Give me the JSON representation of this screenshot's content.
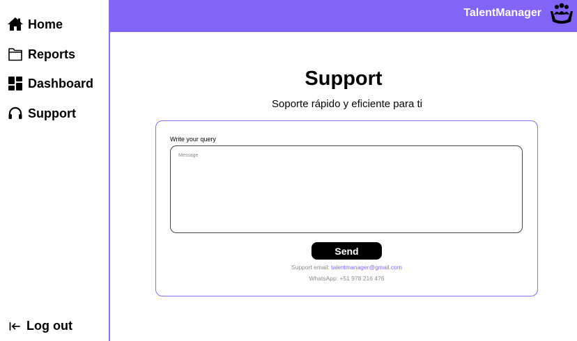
{
  "sidebar": {
    "items": [
      {
        "label": "Home",
        "icon": "home-icon"
      },
      {
        "label": "Reports",
        "icon": "folder-icon"
      },
      {
        "label": "Dashboard",
        "icon": "dashboard-icon"
      },
      {
        "label": "Support",
        "icon": "headset-icon"
      }
    ],
    "logout": {
      "label": "Log out",
      "icon": "logout-icon"
    }
  },
  "header": {
    "brand": "TalentManager",
    "logo": "team-hands-logo",
    "background": "#8264f7"
  },
  "main": {
    "title": "Support",
    "subtitle": "Soporte rápido y eficiente para ti",
    "form": {
      "label": "Write your query",
      "placeholder": "Message",
      "value": "",
      "send_label": "Send"
    },
    "contact": {
      "email_label": "Support email:",
      "email": "talentmanager@gmail.com",
      "whatsapp": "WhatsApp: +51 978 216 476"
    }
  },
  "colors": {
    "accent": "#8264f7",
    "border": "#8b6cf5"
  }
}
